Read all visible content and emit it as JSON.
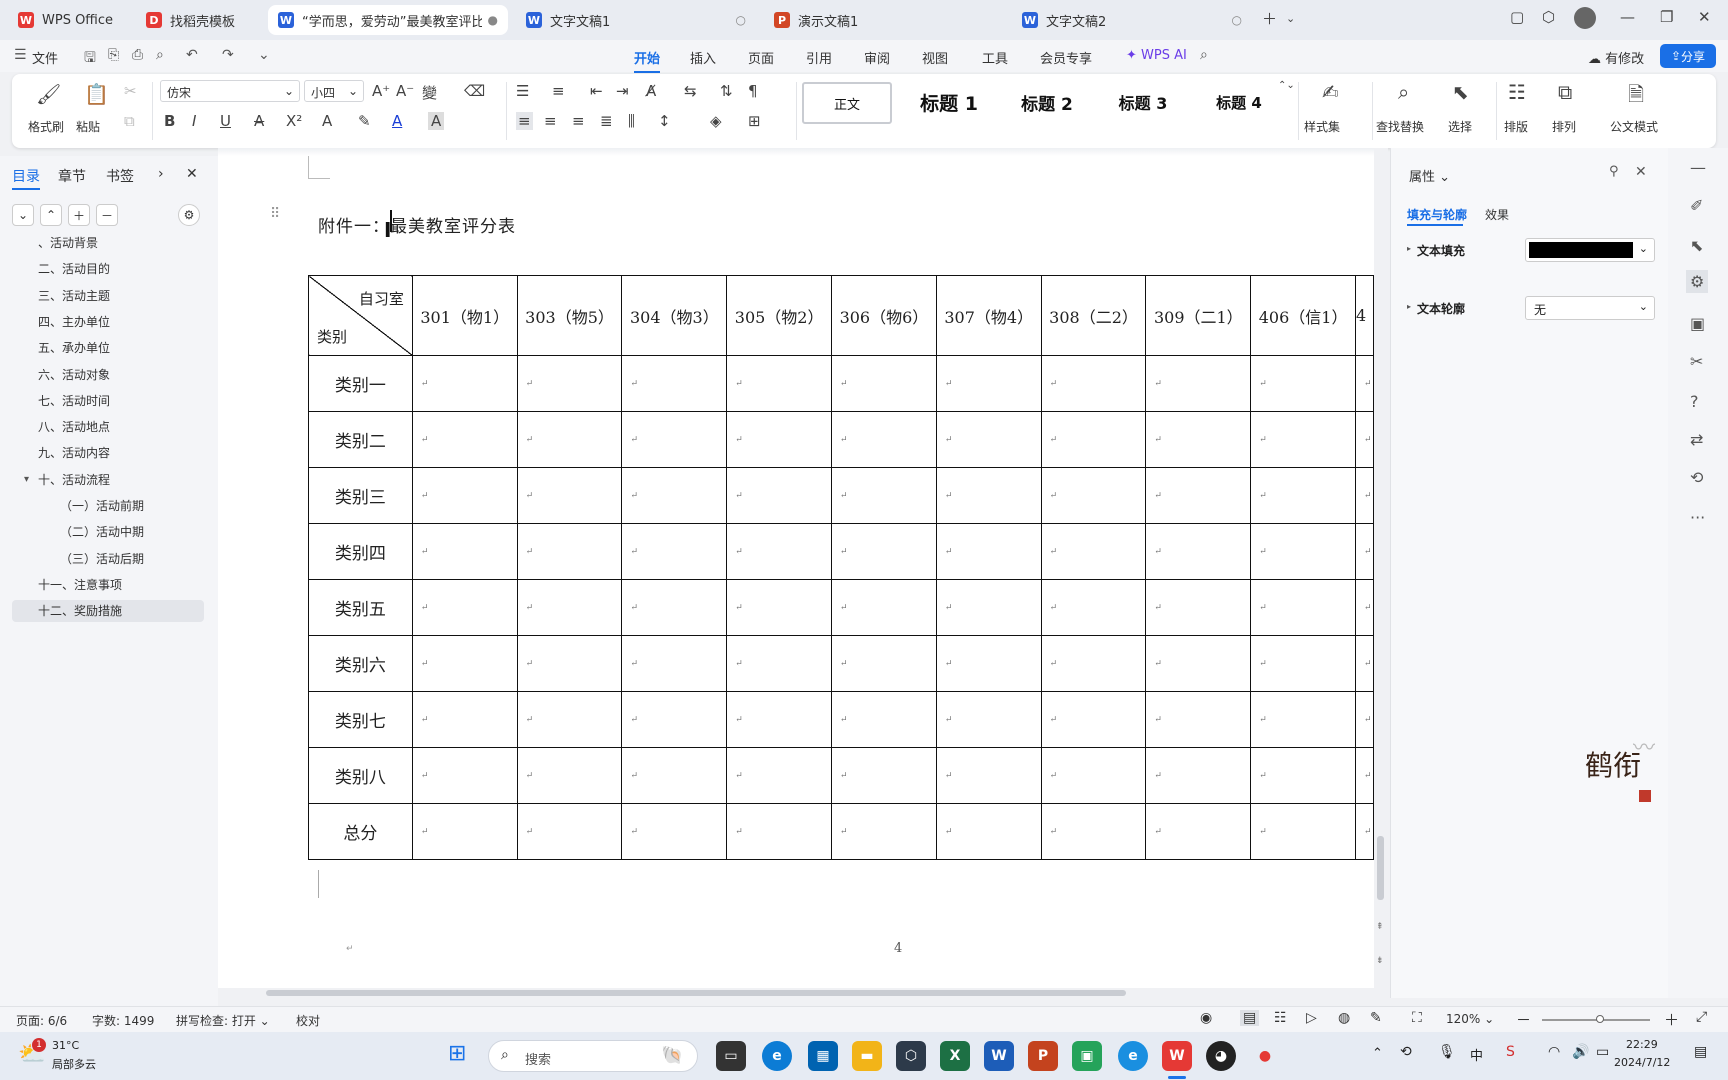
{
  "tabs": [
    {
      "label": "WPS Office",
      "icon": "wps-logo-icon",
      "color": "#e53935"
    },
    {
      "label": "找稻壳模板",
      "icon": "docer-icon",
      "color": "#e53935"
    },
    {
      "label": "“学而思，爱劳动”最美教室评比",
      "icon": "writer-icon",
      "color": "#2b62d9"
    },
    {
      "label": "文字文稿1",
      "icon": "writer-icon",
      "color": "#2b62d9"
    },
    {
      "label": "演示文稿1",
      "icon": "presentation-icon",
      "color": "#d24625"
    },
    {
      "label": "文字文稿2",
      "icon": "writer-icon",
      "color": "#2b62d9"
    }
  ],
  "menu": {
    "file": "文件",
    "items": [
      "开始",
      "插入",
      "页面",
      "引用",
      "审阅",
      "视图",
      "工具",
      "会员专享"
    ],
    "selected": "开始",
    "wps_ai": "WPS AI",
    "has_changes": "有修改",
    "share": "分享"
  },
  "ribbon": {
    "format_painter": "格式刷",
    "paste": "粘贴",
    "font_name": "仿宋",
    "font_size": "小四",
    "styles": [
      "正文",
      "标题 1",
      "标题 2",
      "标题 3",
      "标题 4"
    ],
    "style_set": "样式集",
    "find_replace": "查找替换",
    "select": "选择",
    "layout": "排版",
    "arrange": "排列",
    "official_doc": "公文模式"
  },
  "nav": {
    "tabs": [
      "目录",
      "章节",
      "书签"
    ],
    "items": [
      {
        "label": "、活动背景",
        "indent": 1
      },
      {
        "label": "二、活动目的",
        "indent": 1
      },
      {
        "label": "三、活动主题",
        "indent": 1
      },
      {
        "label": "四、主办单位",
        "indent": 1
      },
      {
        "label": "五、承办单位",
        "indent": 1
      },
      {
        "label": "六、活动对象",
        "indent": 1
      },
      {
        "label": "七、活动时间",
        "indent": 1
      },
      {
        "label": "八、活动地点",
        "indent": 1
      },
      {
        "label": "九、活动内容",
        "indent": 1
      },
      {
        "label": "十、活动流程",
        "indent": 1,
        "expanded": true
      },
      {
        "label": "（一）活动前期",
        "indent": 2
      },
      {
        "label": "（二）活动中期",
        "indent": 2
      },
      {
        "label": "（三）活动后期",
        "indent": 2
      },
      {
        "label": "十一、注意事项",
        "indent": 1
      },
      {
        "label": "十二、奖励措施",
        "indent": 1,
        "current": true
      }
    ]
  },
  "document": {
    "heading": "附件一：最美教室评分表",
    "corner_top": "自习室",
    "corner_bottom": "类别",
    "columns": [
      "301（物1）",
      "303（物5）",
      "304（物3）",
      "305（物2）",
      "306（物6）",
      "307（物4）",
      "308（二2）",
      "309（二1）",
      "406（信1）",
      "4"
    ],
    "rows": [
      "类别一",
      "类别二",
      "类别三",
      "类别四",
      "类别五",
      "类别六",
      "类别七",
      "类别八",
      "总分"
    ],
    "page_number": "4"
  },
  "properties": {
    "title": "属性",
    "tabs": [
      "填充与轮廓",
      "效果"
    ],
    "text_fill_label": "文本填充",
    "text_fill_color": "#000000",
    "text_outline_label": "文本轮廓",
    "text_outline_value": "无"
  },
  "status": {
    "page": "页面: 6/6",
    "words": "字数: 1499",
    "spell": "拼写检查: 打开",
    "proof": "校对",
    "zoom": "120%"
  },
  "taskbar": {
    "weather_temp": "31°C",
    "weather_desc": "局部多云",
    "search_placeholder": "搜索",
    "time": "22:29",
    "date": "2024/7/12",
    "ime": "中"
  },
  "watermark_text": "鹤衔"
}
